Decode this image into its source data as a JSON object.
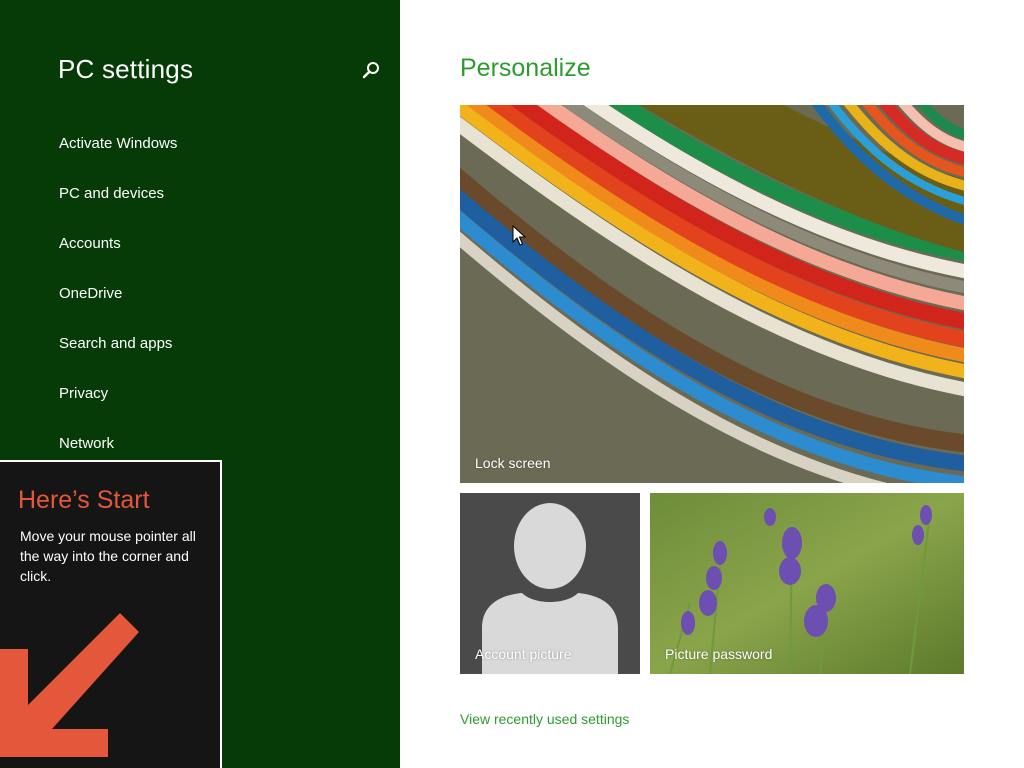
{
  "left_pane": {
    "title": "PC settings",
    "search_icon": "search-icon",
    "nav_items": [
      {
        "label": "Activate Windows"
      },
      {
        "label": "PC and devices"
      },
      {
        "label": "Accounts"
      },
      {
        "label": "OneDrive"
      },
      {
        "label": "Search and apps"
      },
      {
        "label": "Privacy"
      },
      {
        "label": "Network"
      }
    ],
    "background_color": "#063b07"
  },
  "tip": {
    "title": "Here’s Start",
    "body": "Move your mouse pointer all the way into the corner and click.",
    "arrow_icon": "arrow-down-left-icon",
    "accent_color": "#e4573a"
  },
  "main": {
    "title": "Personalize",
    "tiles": {
      "lock_screen": {
        "label": "Lock screen"
      },
      "account_picture": {
        "label": "Account picture"
      },
      "picture_password": {
        "label": "Picture password"
      }
    },
    "recent_link": "View recently used settings",
    "accent_color": "#2e9b2f"
  }
}
